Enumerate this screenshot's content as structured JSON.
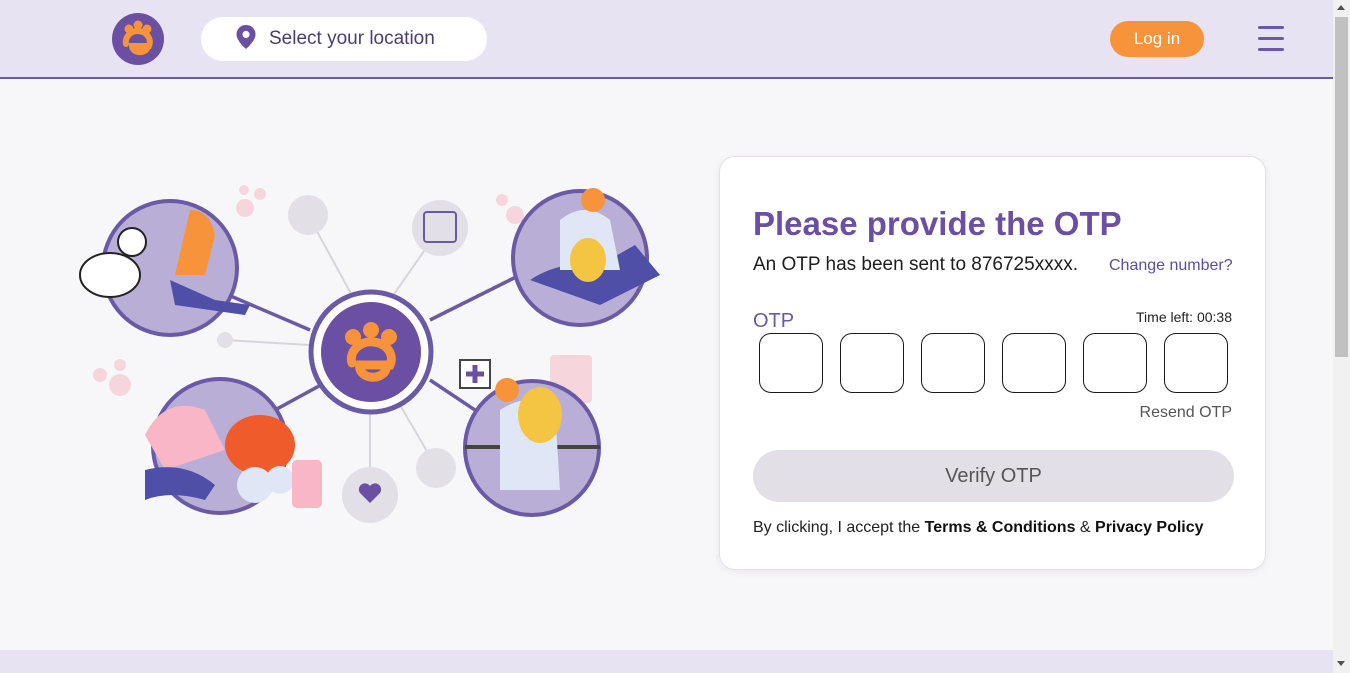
{
  "header": {
    "logo_icon": "paw-e-logo-icon",
    "location": {
      "icon": "location-pin-icon",
      "label": "Select your location"
    },
    "login_label": "Log in",
    "menu_icon": "hamburger-menu-icon"
  },
  "card": {
    "title": "Please provide the OTP",
    "sent_text": "An OTP has been sent to 876725xxxx.",
    "change_number": "Change number?",
    "otp_label": "OTP",
    "time_left": "Time left: 00:38",
    "otp_digits": [
      "",
      "",
      "",
      "",
      "",
      ""
    ],
    "resend": "Resend OTP",
    "verify_label": "Verify OTP",
    "terms_prefix": "By clicking, I accept the ",
    "terms_link": "Terms & Conditions",
    "terms_amp": " & ",
    "privacy_link": "Privacy Policy"
  },
  "colors": {
    "brand_purple": "#6a4fa3",
    "accent_orange": "#f7933a",
    "header_bg": "#e8e3f3",
    "verify_disabled_bg": "#e2e0e6"
  }
}
